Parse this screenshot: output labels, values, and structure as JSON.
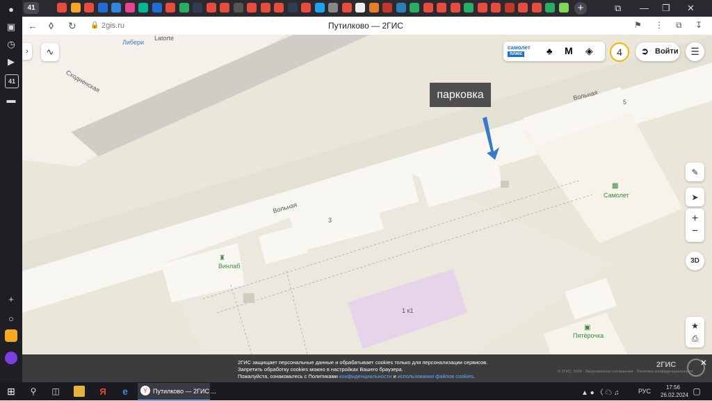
{
  "browser": {
    "tab_count": "41",
    "url": "2gis.ru",
    "page_title": "Путилково — 2ГИС",
    "tab_colors": [
      "#e74c3c",
      "#f5a623",
      "#e74c3c",
      "#1d6fd6",
      "#2e86de",
      "#e84393",
      "#00b894",
      "#1d6fd6",
      "#e74c3c",
      "#27ae60",
      "#2c3e50",
      "#e74c3c",
      "#e74c3c",
      "#555",
      "#e74c3c",
      "#e74c3c",
      "#e74c3c",
      "#2c3e50",
      "#e74c3c",
      "#1da1f2",
      "#888",
      "#e74c3c",
      "#eee",
      "#e67e22",
      "#c0392b",
      "#2980b9",
      "#27ae60",
      "#e74c3c",
      "#e74c3c",
      "#e74c3c",
      "#27ae60",
      "#e74c3c",
      "#e74c3c",
      "#c0392b",
      "#e74c3c",
      "#e74c3c",
      "#27ae60",
      "#7ed957"
    ]
  },
  "map": {
    "street_labels": {
      "skhodnenskaya": "Сходненская",
      "volnaya_1": "Вольная",
      "volnaya_2": "Вольная"
    },
    "place_labels": {
      "liberi": "Либери",
      "latorte": "Latorte",
      "vinlab": "Винлаб",
      "samolet": "Самолет",
      "pyaterochka": "Пятёрочка"
    },
    "building_numbers": {
      "b3": "3",
      "b5": "5",
      "b1k1": "1 к1"
    },
    "parking_callout": "парковка"
  },
  "controls": {
    "samolet_brand": "самолет",
    "samolet_plus": "плюс",
    "notifications": "4",
    "login_label": "Войти",
    "three_d": "3D",
    "zoom_in": "+",
    "zoom_out": "−"
  },
  "cookie": {
    "line1": "2ГИС защищает персональные данные и обрабатывает cookies только для персонализации сервисов.",
    "line2": "Запретить обработку cookies можно в настройках Вашего браузера.",
    "line3_pre": "Пожалуйста, ознакомьтесь с Политиками ",
    "line3_link1": "конфиденциальности",
    "line3_mid": " и ",
    "line3_link2": "использования файлов cookies",
    "line3_post": ".",
    "logo": "2ГИС",
    "copyright": "© 2ГИС, 2024 · Лицензионное соглашение · Политика конфиденциальности"
  },
  "taskbar": {
    "window_title": "Путилково — 2ГИС ...",
    "lang": "РУС",
    "time": "17:56",
    "date": "26.02.2024"
  },
  "sidebar": {
    "badge": "41"
  }
}
